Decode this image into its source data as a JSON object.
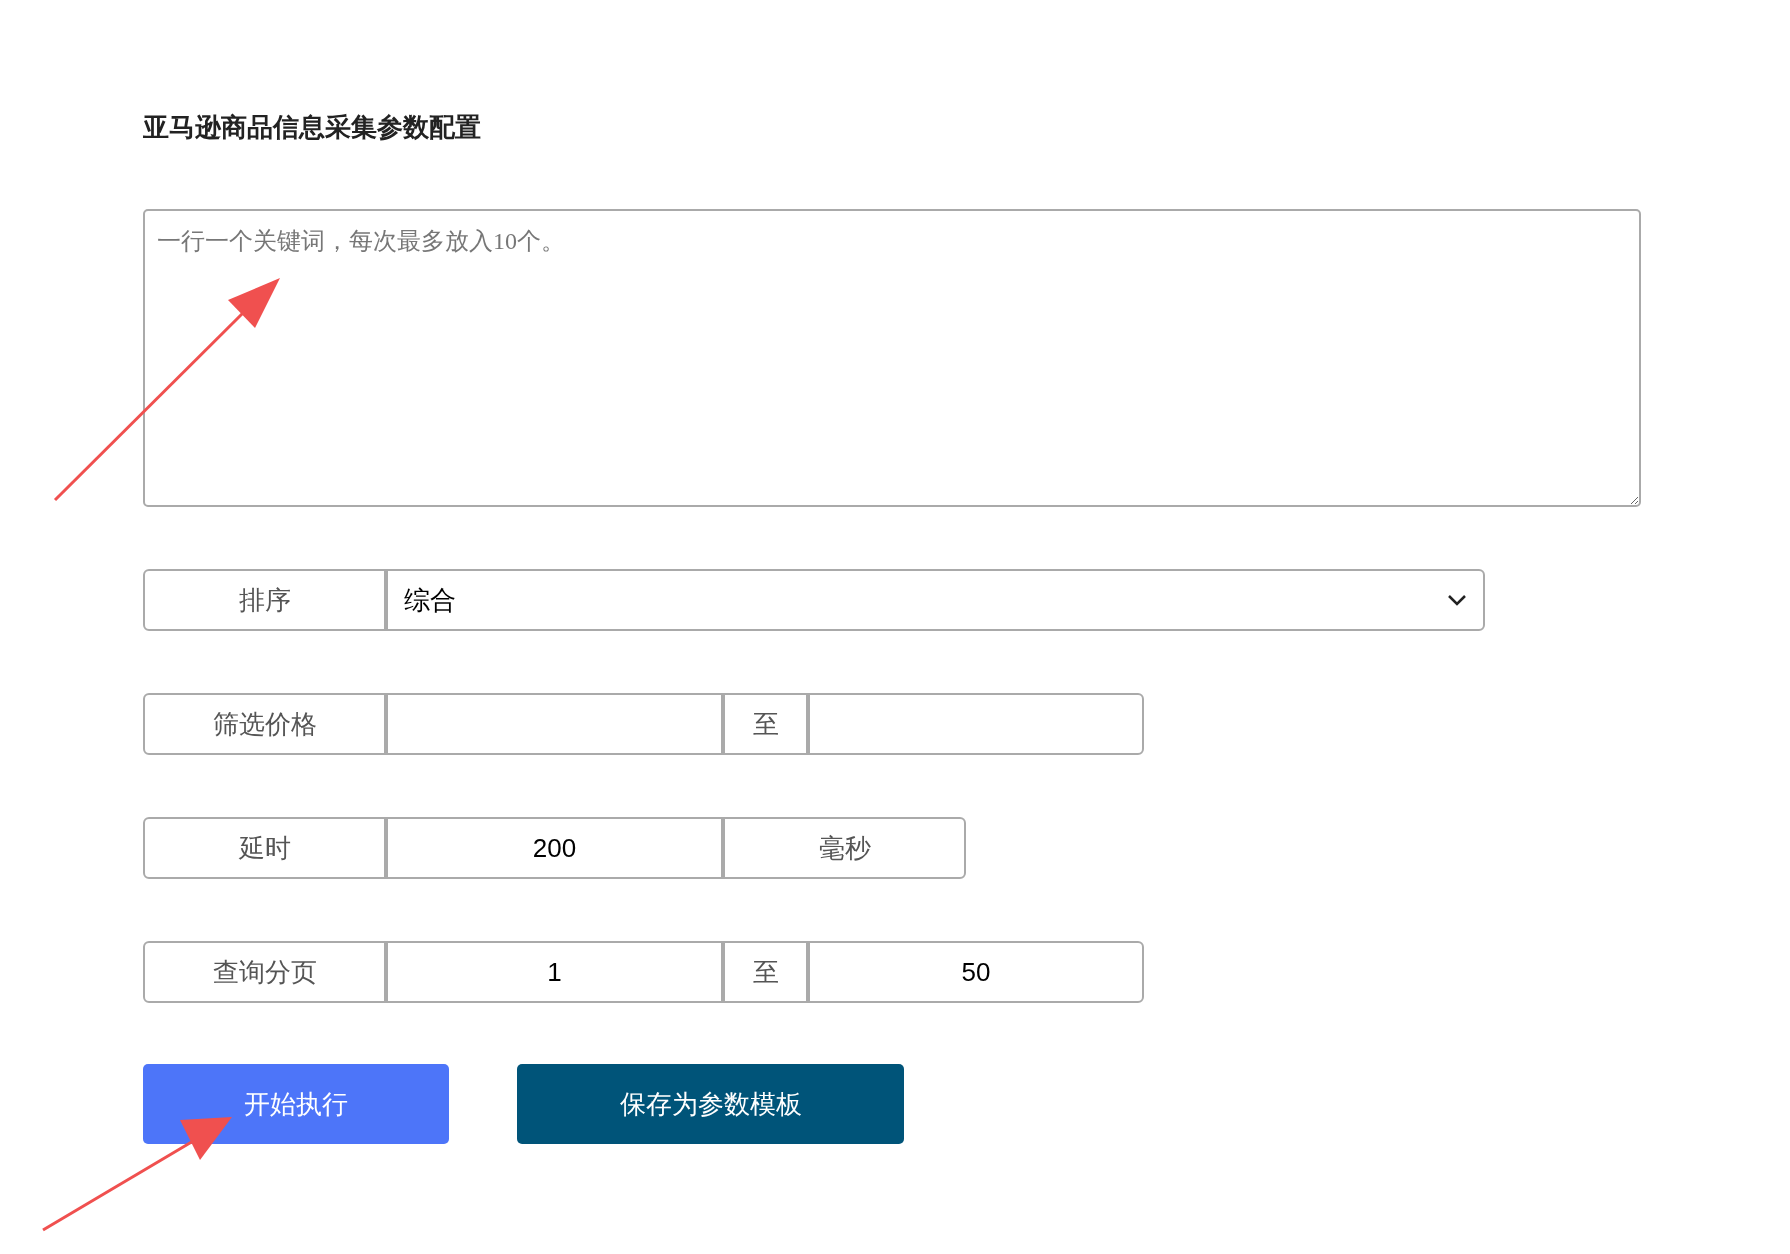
{
  "title": "亚马逊商品信息采集参数配置",
  "keywords": {
    "placeholder": "一行一个关键词，每次最多放入10个。"
  },
  "rows": [
    {
      "kind": "select",
      "label": "排序",
      "value": "综合"
    },
    {
      "kind": "range",
      "label": "筛选价格",
      "separator": "至"
    },
    {
      "kind": "unit",
      "label": "延时",
      "value": "200",
      "unit": "毫秒"
    },
    {
      "kind": "range",
      "label": "查询分页",
      "from": "1",
      "separator": "至",
      "to": "50"
    }
  ],
  "buttons": [
    {
      "label": "开始执行",
      "kind": "primary"
    },
    {
      "label": "保存为参数模板",
      "kind": "secondary"
    }
  ]
}
